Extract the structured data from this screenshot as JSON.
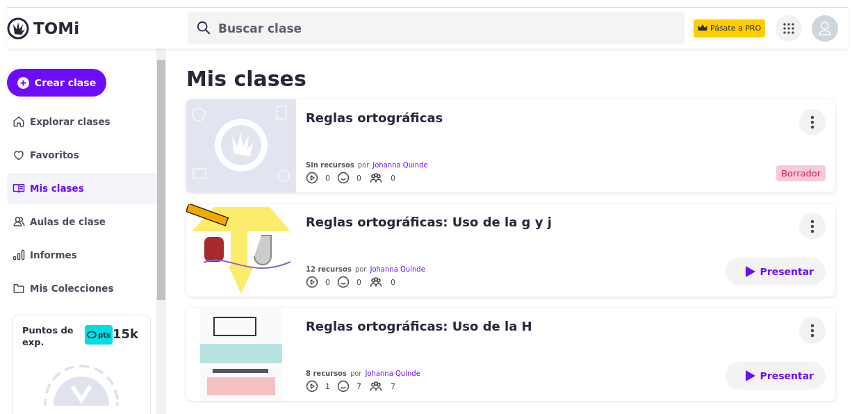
{
  "header": {
    "logo": "TOMi",
    "search": {
      "placeholder": "Buscar clase"
    },
    "pro_button": "Pásate a PRO"
  },
  "sidebar": {
    "create_button": "Crear clase",
    "items": [
      {
        "label": "Explorar clases",
        "selected": false
      },
      {
        "label": "Favoritos",
        "selected": false
      },
      {
        "label": "Mis clases",
        "selected": true
      },
      {
        "label": "Aulas de clase",
        "selected": false
      },
      {
        "label": "Informes",
        "selected": false
      },
      {
        "label": "Mis Colecciones",
        "selected": false
      }
    ],
    "points": {
      "label": "Puntos de exp.",
      "badge": "pts",
      "value": "15k"
    }
  },
  "page_title": "Mis clases",
  "classes": [
    {
      "title": "Reglas ortográficas",
      "resources": "Sin recursos",
      "by": "por",
      "author": "Johanna Quinde",
      "plays": "0",
      "reactions": "0",
      "participants": "0",
      "action": {
        "kind": "status",
        "label": "Borrador"
      }
    },
    {
      "title": "Reglas ortográficas: Uso de la g y j",
      "resources": "12 recursos",
      "by": "por",
      "author": "Johanna Quinde",
      "plays": "0",
      "reactions": "0",
      "participants": "0",
      "action": {
        "kind": "button",
        "label": "Presentar"
      }
    },
    {
      "title": "Reglas ortográficas: Uso de la H",
      "resources": "8 recursos",
      "by": "por",
      "author": "Johanna Quinde",
      "plays": "1",
      "reactions": "7",
      "participants": "7",
      "action": {
        "kind": "button",
        "label": "Presentar"
      }
    }
  ]
}
